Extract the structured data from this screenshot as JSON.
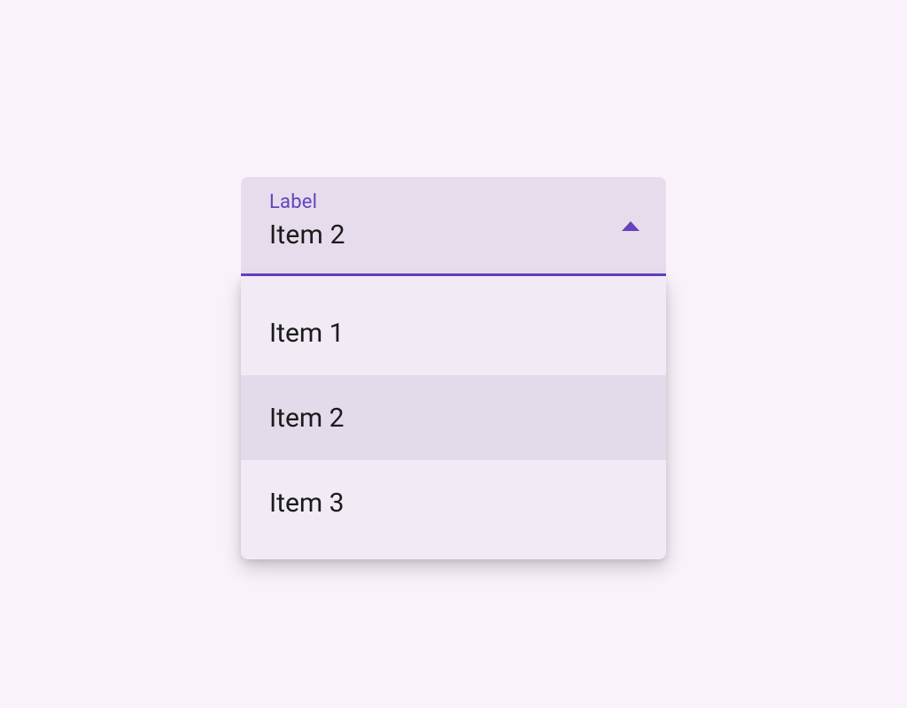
{
  "select": {
    "label": "Label",
    "value": "Item 2",
    "options": [
      "Item 1",
      "Item 2",
      "Item 3"
    ],
    "selected_index": 1
  },
  "colors": {
    "accent": "#6442c0",
    "field_bg": "#e6dceb",
    "menu_bg": "#f2ebf6",
    "menu_selected": "#e4dbea",
    "page_bg": "#faf2fb",
    "text": "#1b1b1b"
  }
}
